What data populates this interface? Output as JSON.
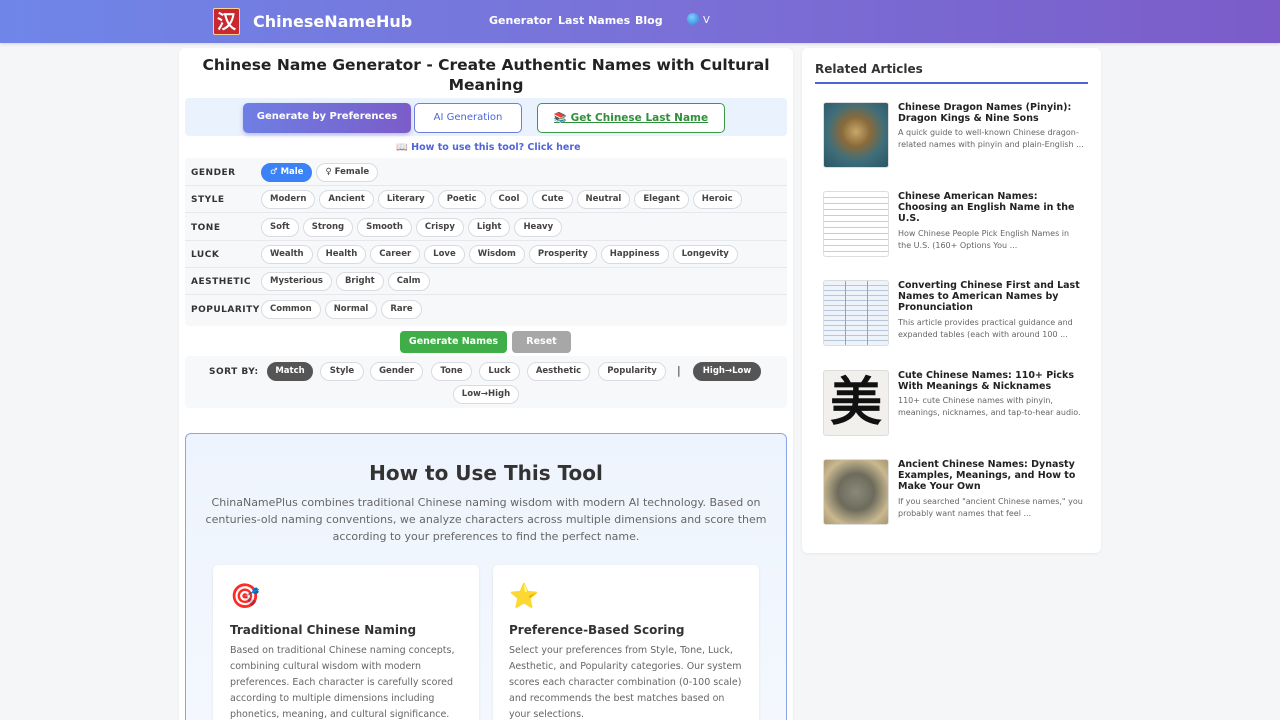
{
  "header": {
    "logo_glyph": "汉",
    "brand": "ChineseNameHub",
    "nav": [
      "Generator",
      "Last Names",
      "Blog"
    ],
    "lang_label": "V"
  },
  "main": {
    "title": "Chinese Name Generator - Create Authentic Names with Cultural Meaning",
    "tabs": {
      "preferences": "Generate by Preferences",
      "ai": "AI Generation",
      "last_name": "📚 Get Chinese Last Name"
    },
    "howto_link": "📖 How to use this tool? Click here",
    "filters": [
      {
        "label": "GENDER",
        "options": [
          "♂ Male",
          "♀ Female"
        ],
        "active": 0
      },
      {
        "label": "STYLE",
        "options": [
          "Modern",
          "Ancient",
          "Literary",
          "Poetic",
          "Cool",
          "Cute",
          "Neutral",
          "Elegant",
          "Heroic"
        ],
        "active": -1
      },
      {
        "label": "TONE",
        "options": [
          "Soft",
          "Strong",
          "Smooth",
          "Crispy",
          "Light",
          "Heavy"
        ],
        "active": -1
      },
      {
        "label": "LUCK",
        "options": [
          "Wealth",
          "Health",
          "Career",
          "Love",
          "Wisdom",
          "Prosperity",
          "Happiness",
          "Longevity"
        ],
        "active": -1
      },
      {
        "label": "AESTHETIC",
        "options": [
          "Mysterious",
          "Bright",
          "Calm"
        ],
        "active": -1
      },
      {
        "label": "POPULARITY",
        "options": [
          "Common",
          "Normal",
          "Rare"
        ],
        "active": -1
      }
    ],
    "generate_label": "Generate Names",
    "reset_label": "Reset",
    "sort": {
      "label": "SORT BY:",
      "options": [
        "Match",
        "Style",
        "Gender",
        "Tone",
        "Luck",
        "Aesthetic",
        "Popularity"
      ],
      "separator": "|",
      "high_low": "High→Low",
      "low_high": "Low→High"
    },
    "howto": {
      "title": "How to Use This Tool",
      "description": "ChinaNamePlus combines traditional Chinese naming wisdom with modern AI technology. Based on centuries-old naming conventions, we analyze characters across multiple dimensions and score them according to your preferences to find the perfect name.",
      "features": [
        {
          "icon": "🎯",
          "title": "Traditional Chinese Naming",
          "desc": "Based on traditional Chinese naming concepts, combining cultural wisdom with modern preferences. Each character is carefully scored according to multiple dimensions including phonetics, meaning, and cultural significance."
        },
        {
          "icon": "⭐",
          "title": "Preference-Based Scoring",
          "desc": "Select your preferences from Style, Tone, Luck, Aesthetic, and Popularity categories. Our system scores each character combination (0-100 scale) and recommends the best matches based on your selections."
        }
      ]
    }
  },
  "sidebar": {
    "title": "Related Articles",
    "articles": [
      {
        "title": "Chinese Dragon Names (Pinyin): Dragon Kings & Nine Sons",
        "desc": "A quick guide to well-known Chinese dragon-related names with pinyin and plain-English ..."
      },
      {
        "title": "Chinese American Names: Choosing an English Name in the U.S.",
        "desc": "How Chinese People Pick English Names in the U.S. (160+ Options You ..."
      },
      {
        "title": "Converting Chinese First and Last Names to American Names by Pronunciation",
        "desc": "This article provides practical guidance and expanded tables (each with around 100 ..."
      },
      {
        "title": "Cute Chinese Names: 110+ Picks With Meanings & Nicknames",
        "desc": "110+ cute Chinese names with pinyin, meanings, nicknames, and tap-to-hear audio.",
        "thumb_glyph": "美"
      },
      {
        "title": "Ancient Chinese Names: Dynasty Examples, Meanings, and How to Make Your Own",
        "desc": "If you searched \"ancient Chinese names,\" you probably want names that feel ..."
      }
    ]
  }
}
